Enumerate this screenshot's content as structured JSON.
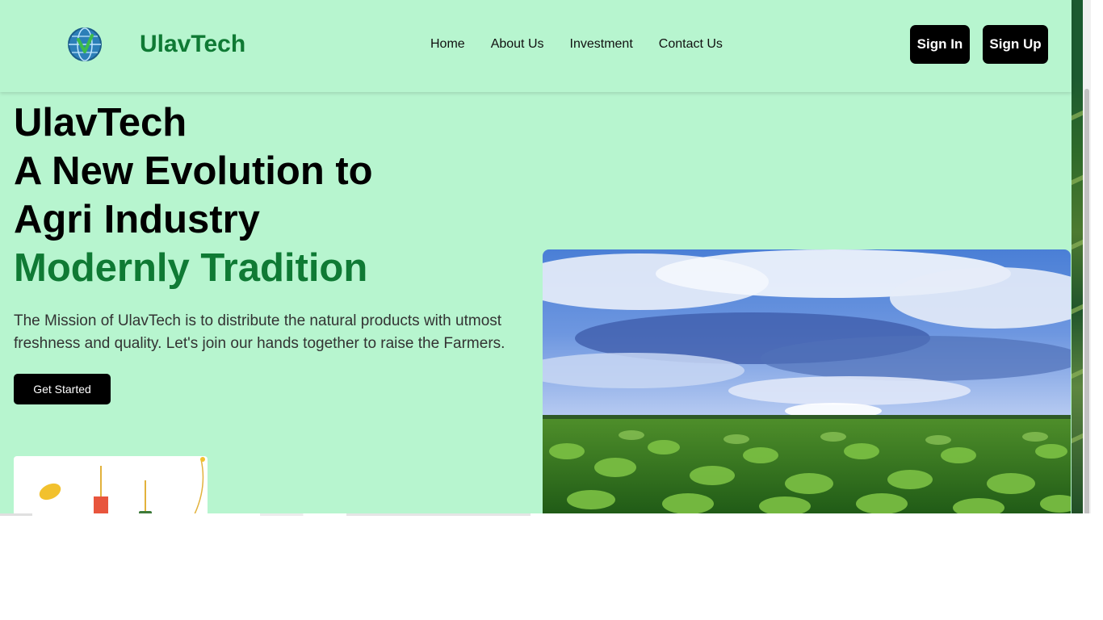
{
  "header": {
    "brand": "UlavTech",
    "nav": [
      "Home",
      "About Us",
      "Investment",
      "Contact Us"
    ],
    "sign_in": "Sign In",
    "sign_up": "Sign Up"
  },
  "hero": {
    "line1": "UlavTech",
    "line2": "A New Evolution to",
    "line3": "Agri Industry",
    "line4": "Modernly Tradition",
    "description": "The Mission of UlavTech is to distribute the natural products with utmost freshness and quality. Let's join our hands together to raise the Farmers.",
    "cta": "Get Started"
  },
  "colors": {
    "background": "#b7f5cf",
    "accent_green": "#0f7a34",
    "button": "#000000"
  }
}
